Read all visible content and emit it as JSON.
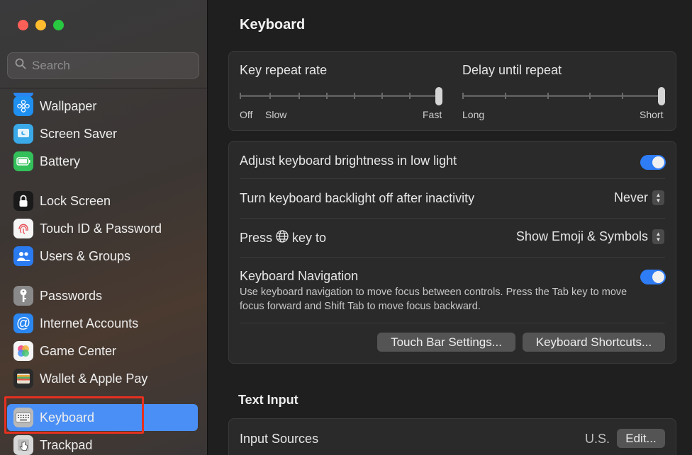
{
  "window": {
    "traffic_lights": [
      "close",
      "minimize",
      "zoom"
    ]
  },
  "search": {
    "placeholder": "Search"
  },
  "sidebar": {
    "items": [
      {
        "label": "Wallpaper",
        "icon": "flower-icon",
        "color": "#1f8ff0"
      },
      {
        "label": "Screen Saver",
        "icon": "screen-saver-icon",
        "color": "#3aa9e8"
      },
      {
        "label": "Battery",
        "icon": "battery-icon",
        "color": "#33c05a"
      },
      {
        "label": "Lock Screen",
        "icon": "lock-icon",
        "color": "#1a1a1a"
      },
      {
        "label": "Touch ID & Password",
        "icon": "fingerprint-icon",
        "color": "#f5f5f5"
      },
      {
        "label": "Users & Groups",
        "icon": "users-icon",
        "color": "#2a7bf0"
      },
      {
        "label": "Passwords",
        "icon": "key-icon",
        "color": "#8a8a8a"
      },
      {
        "label": "Internet Accounts",
        "icon": "at-icon",
        "color": "#2a86f0"
      },
      {
        "label": "Game Center",
        "icon": "game-center-icon",
        "color": "#f5f5f5"
      },
      {
        "label": "Wallet & Apple Pay",
        "icon": "wallet-icon",
        "color": "#2b2b2b"
      },
      {
        "label": "Keyboard",
        "icon": "keyboard-icon",
        "color": "#b9b9b9",
        "active": true
      },
      {
        "label": "Trackpad",
        "icon": "trackpad-icon",
        "color": "#d8d8d8"
      }
    ]
  },
  "main": {
    "title": "Keyboard",
    "key_repeat": {
      "label": "Key repeat rate",
      "min_label": "Off",
      "slow_label": "Slow",
      "max_label": "Fast",
      "value": 1.0
    },
    "delay_repeat": {
      "label": "Delay until repeat",
      "min_label": "Long",
      "max_label": "Short",
      "value": 1.0
    },
    "brightness": {
      "label": "Adjust keyboard brightness in low light",
      "on": true
    },
    "backlight": {
      "label": "Turn keyboard backlight off after inactivity",
      "value": "Never"
    },
    "globe_key": {
      "label_before": "Press",
      "label_after": "key to",
      "value": "Show Emoji & Symbols"
    },
    "navigation": {
      "label": "Keyboard Navigation",
      "description": "Use keyboard navigation to move focus between controls. Press the Tab key to move focus forward and Shift Tab to move focus backward.",
      "on": true
    },
    "buttons": {
      "touch_bar": "Touch Bar Settings...",
      "shortcuts": "Keyboard Shortcuts..."
    },
    "text_input": {
      "title": "Text Input",
      "input_sources_label": "Input Sources",
      "input_sources_value": "U.S.",
      "edit_label": "Edit..."
    }
  }
}
